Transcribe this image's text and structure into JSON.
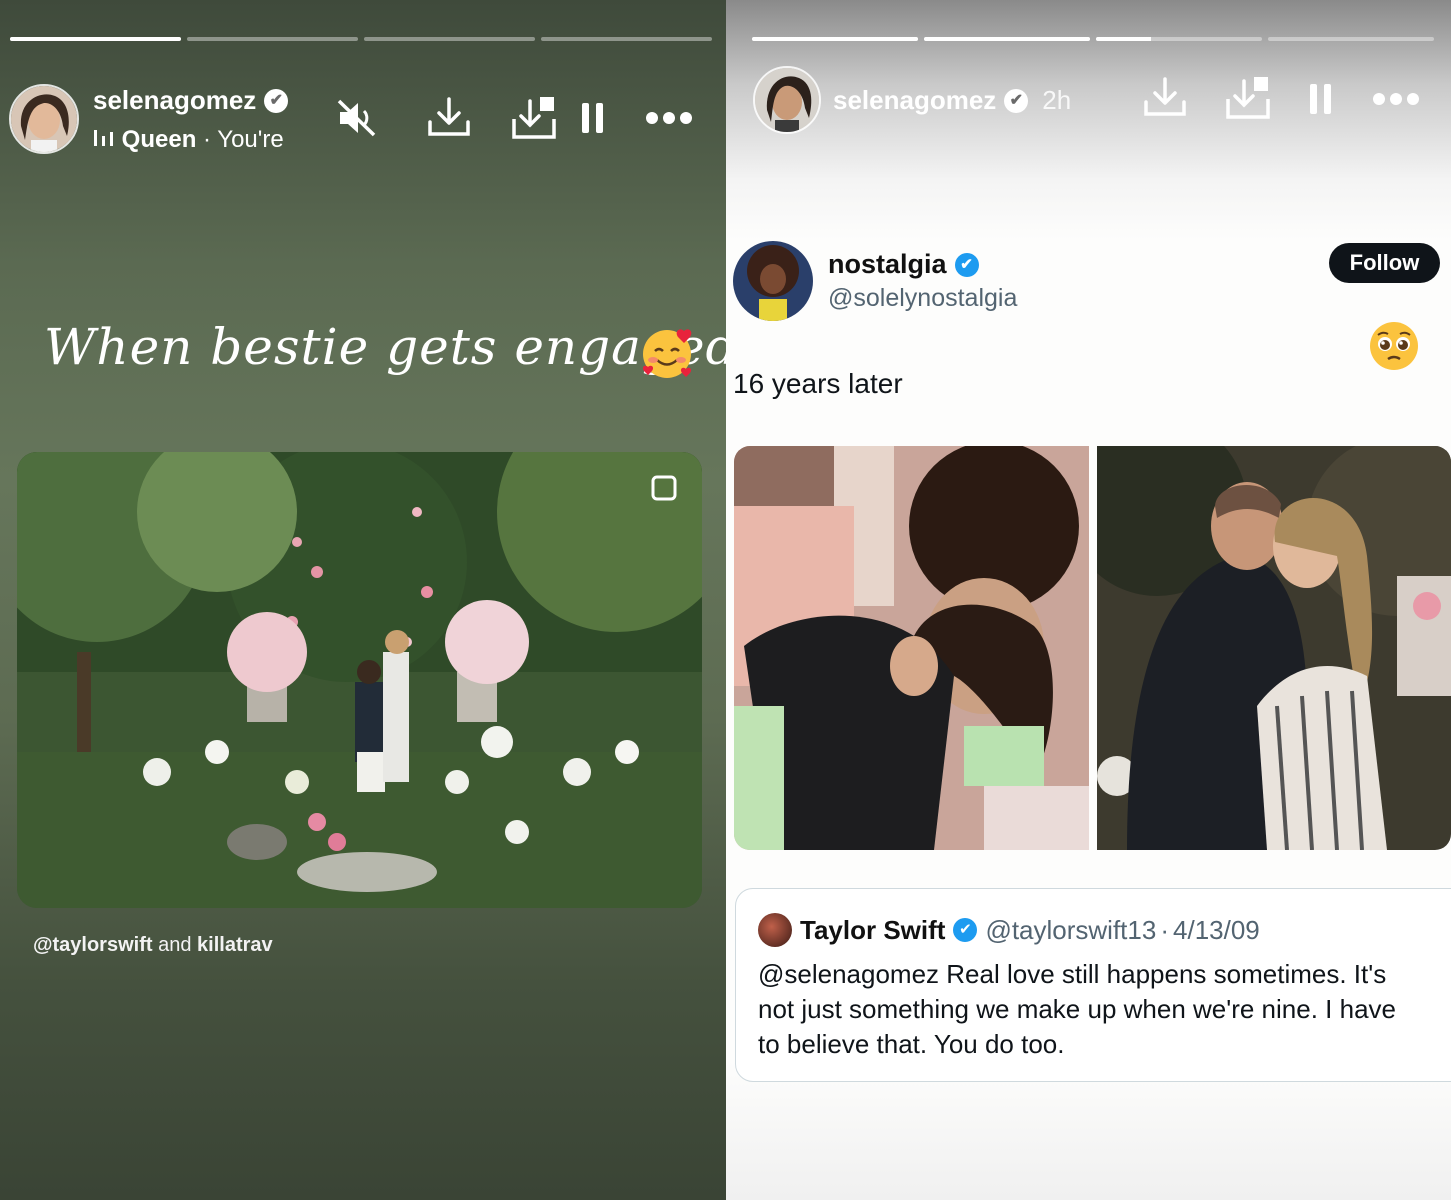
{
  "left_story": {
    "username": "selenagomez",
    "music": {
      "track": "Queen",
      "artist": "You're"
    },
    "title_text": "When bestie gets engaged",
    "tags": {
      "first": "@taylorswift",
      "joiner": "and",
      "second": "killatrav"
    },
    "progress": [
      1.0,
      0.0,
      0.0,
      0.0
    ],
    "icons": [
      "mute-icon",
      "download-icon",
      "save-to-archive-icon",
      "pause-icon",
      "more-icon"
    ]
  },
  "right_story": {
    "username": "selenagomez",
    "time": "2h",
    "progress": [
      1.0,
      1.0,
      0.33,
      0.0
    ],
    "icons": [
      "download-icon",
      "save-to-archive-icon",
      "pause-icon",
      "more-icon"
    ],
    "post": {
      "display_name": "nostalgia",
      "handle": "@solelynostalgia",
      "follow_label": "Follow",
      "text": "16 years later",
      "quoted": {
        "name": "Taylor Swift",
        "handle": "@taylorswift13",
        "separator": "·",
        "date": "4/13/09",
        "text": "@selenagomez Real love still happens sometimes. It's\nnot just something we make up when we're nine. I have\nto believe that. You do too."
      }
    }
  },
  "colors": {
    "twitter_blue": "#1d9bf0",
    "follow_button": "#0f1419",
    "left_bg": "#5b6a52"
  }
}
